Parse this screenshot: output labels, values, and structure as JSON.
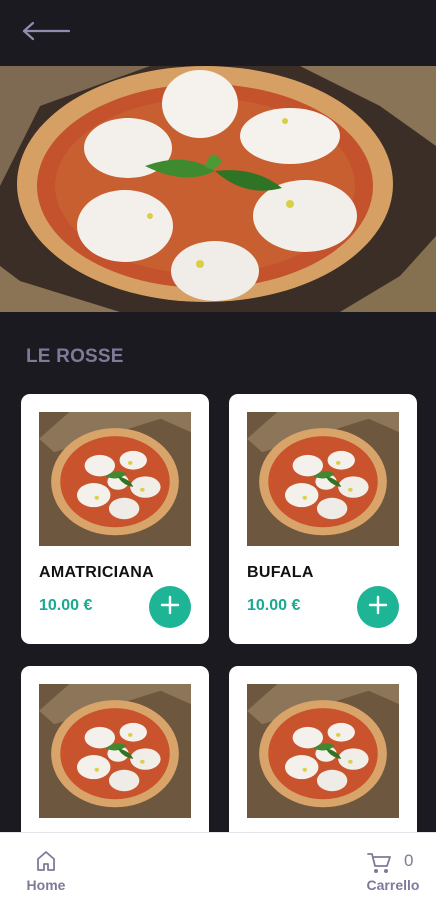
{
  "header": {
    "back_icon": "arrow-left-icon"
  },
  "hero": {
    "image": "margherita-pizza-photo"
  },
  "section": {
    "title": "LE ROSSE"
  },
  "colors": {
    "background": "#1c1a21",
    "accent": "#1db595",
    "price": "#1aa890",
    "muted": "#7d7b98"
  },
  "products": [
    {
      "name": "AMATRICIANA",
      "price": "10.00 €"
    },
    {
      "name": "BUFALA",
      "price": "10.00 €"
    },
    {
      "name": "",
      "price": ""
    },
    {
      "name": "",
      "price": ""
    }
  ],
  "nav": {
    "home_label": "Home",
    "cart_label": "Carrello",
    "cart_count": "0"
  }
}
